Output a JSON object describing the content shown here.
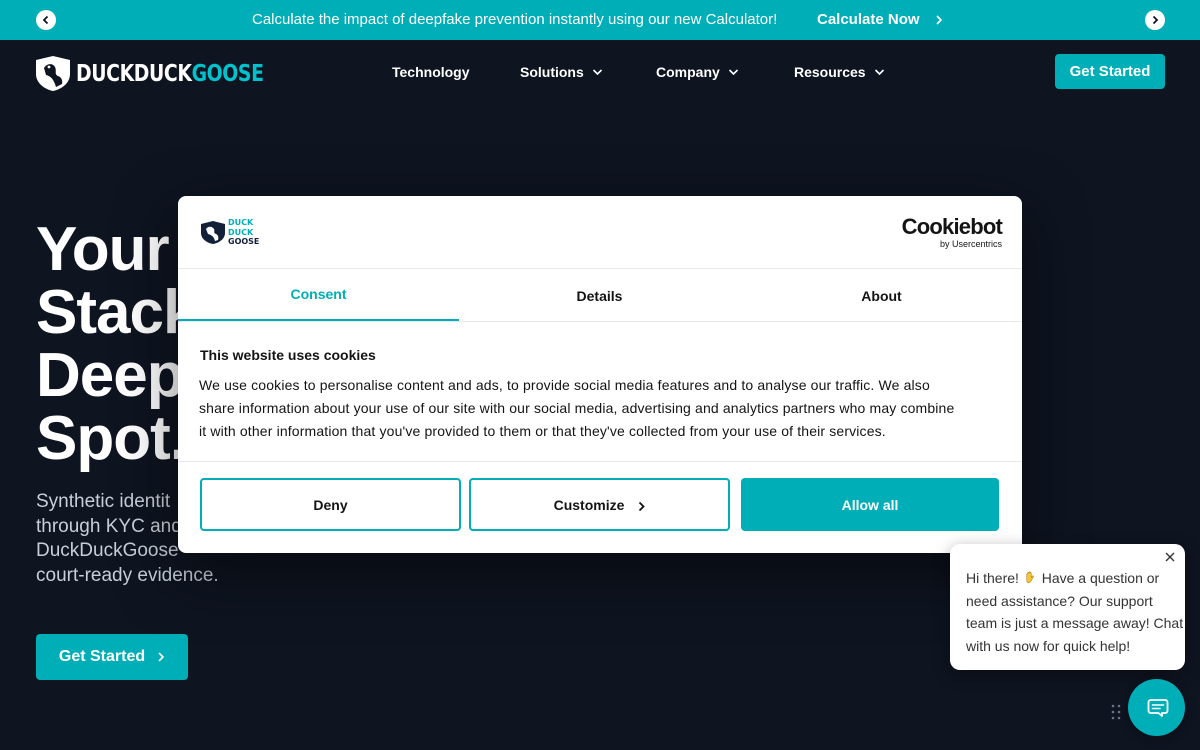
{
  "announcement": {
    "text": "Calculate the impact of deepfake prevention instantly using our new Calculator!",
    "cta": "Calculate Now",
    "prev_icon": "chevron-left-icon",
    "next_icon": "chevron-right-icon"
  },
  "header": {
    "logo": {
      "part1": "DUCKDUCK",
      "part2": "GOOSE"
    },
    "nav": [
      {
        "label": "Technology",
        "has_dropdown": false
      },
      {
        "label": "Solutions",
        "has_dropdown": true
      },
      {
        "label": "Company",
        "has_dropdown": true
      },
      {
        "label": "Resources",
        "has_dropdown": true
      }
    ],
    "cta": "Get Started"
  },
  "hero": {
    "title_lines": [
      "Your",
      "Stack",
      "Deep",
      "Spot."
    ],
    "subtitle_lines": [
      "Synthetic identit",
      "through KYC and",
      "DuckDuckGoose",
      "court-ready evidence."
    ],
    "cta": "Get Started"
  },
  "cookie_dialog": {
    "logo_words": [
      "DUCK",
      "DUCK",
      "GOOSE"
    ],
    "provider_name": "Cookiebot",
    "provider_by": "by Usercentrics",
    "tabs": [
      {
        "label": "Consent",
        "active": true
      },
      {
        "label": "Details",
        "active": false
      },
      {
        "label": "About",
        "active": false
      }
    ],
    "heading": "This website uses cookies",
    "body_lines": [
      "We use cookies to personalise content and ads, to provide social media features and to analyse our traffic. We also",
      "share information about your use of our site with our social media, advertising and analytics partners who may combine",
      "it with other information that you've provided to them or that they've collected from your use of their services."
    ],
    "buttons": {
      "deny": "Deny",
      "customize": "Customize",
      "allow_all": "Allow all"
    }
  },
  "chat": {
    "line1_before_emoji": "Hi there!",
    "line1_after_emoji": "Have a question or",
    "lines": [
      "need assistance? Our support",
      "team is just a message away! Chat",
      "with us now for quick help!"
    ],
    "emoji_icon": "waving-hand-icon",
    "launcher_icon": "chat-bubbles-icon"
  },
  "colors": {
    "accent": "#00aeb8",
    "page_bg": "#0e1420",
    "text_dark": "#141414"
  }
}
